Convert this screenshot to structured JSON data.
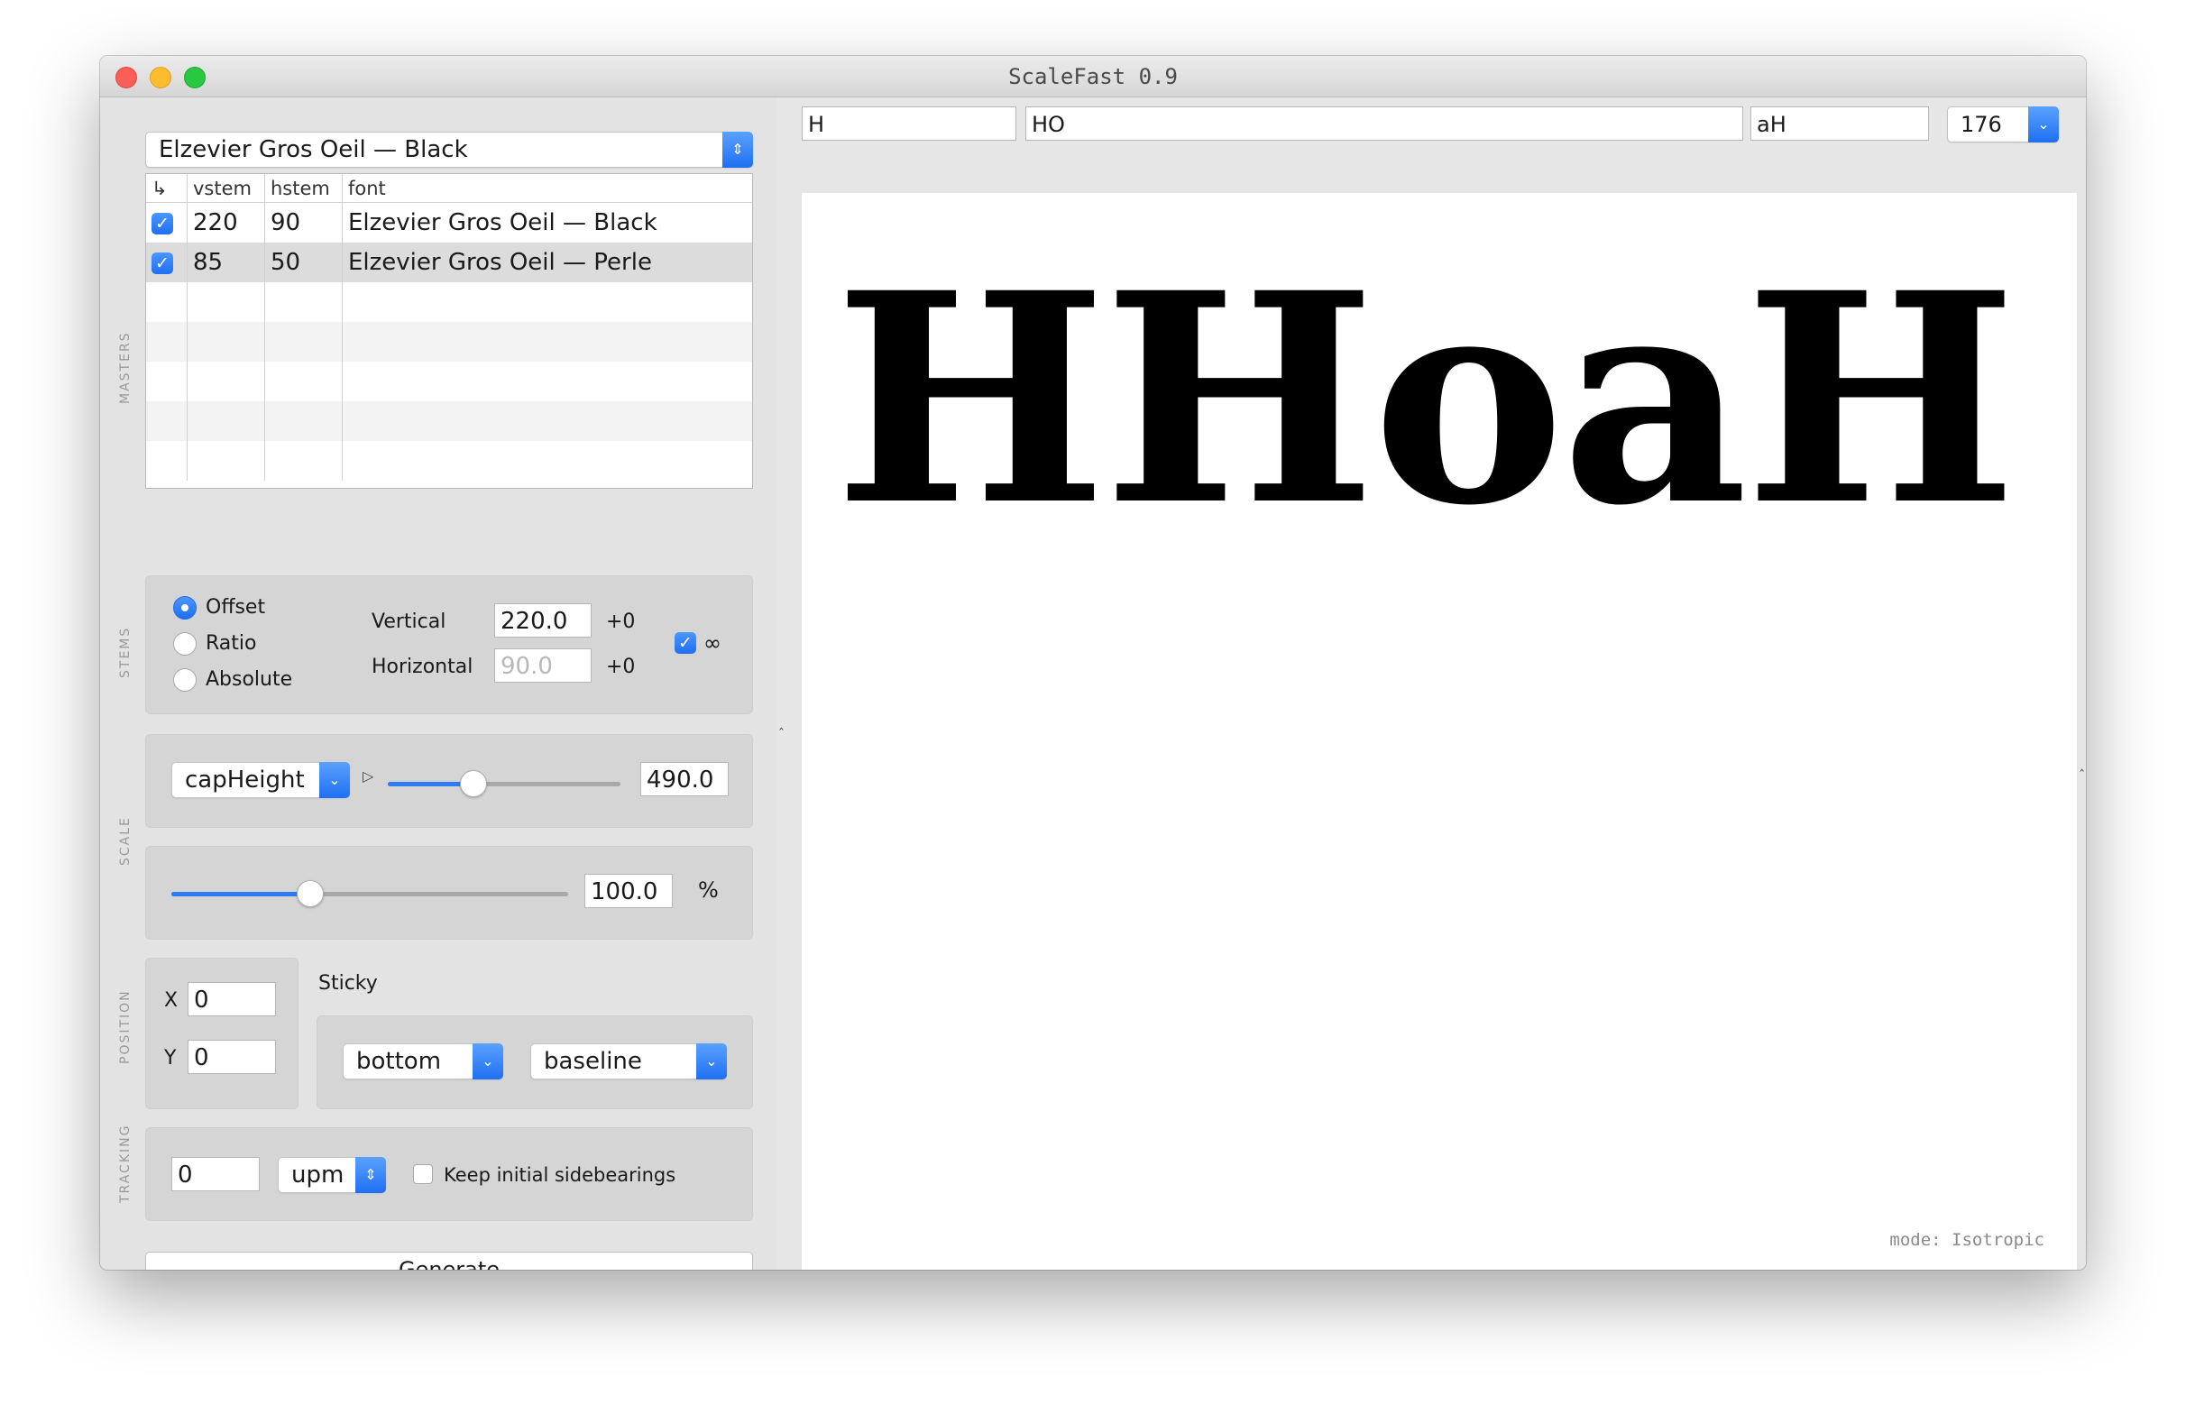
{
  "window": {
    "title": "ScaleFast 0.9"
  },
  "sections": {
    "masters": "MASTERS",
    "stems": "STEMS",
    "scale": "SCALE",
    "position": "POSITION",
    "tracking": "TRACKING"
  },
  "font_select": {
    "value": "Elzevier Gros Oeil — Black"
  },
  "masters_table": {
    "columns": [
      "↳",
      "vstem",
      "hstem",
      "font"
    ],
    "rows": [
      {
        "checked": true,
        "vstem": "220",
        "hstem": "90",
        "font": "Elzevier Gros Oeil — Black"
      },
      {
        "checked": true,
        "vstem": "85",
        "hstem": "50",
        "font": "Elzevier Gros Oeil — Perle"
      }
    ]
  },
  "stems": {
    "modes": [
      "Offset",
      "Ratio",
      "Absolute"
    ],
    "selected_mode": "Offset",
    "vertical_label": "Vertical",
    "vertical_value": "220.0",
    "vertical_delta": "+0",
    "horizontal_label": "Horizontal",
    "horizontal_value": "90.0",
    "horizontal_delta": "+0",
    "link_symbol": "∞",
    "linked": true
  },
  "scale": {
    "reference": "capHeight",
    "play_symbol": "▷",
    "height_value": "490.0",
    "height_slider_level": 0.37,
    "percent_value": "100.0",
    "percent_symbol": "%",
    "percent_slider_level": 0.35
  },
  "position": {
    "x_label": "X",
    "x_value": "0",
    "y_label": "Y",
    "y_value": "0",
    "sticky_label": "Sticky",
    "sticky_vertical": "bottom",
    "sticky_anchor": "baseline"
  },
  "tracking": {
    "value": "0",
    "unit": "upm",
    "keep_sidebearings_label": "Keep initial sidebearings",
    "keep_sidebearings": false
  },
  "generate_label": "Generate",
  "preview": {
    "string_1": "H",
    "string_2": "HO",
    "string_3": "aH",
    "size": "176",
    "sample": "HHoaH",
    "mode": "mode: Isotropic"
  },
  "colors": {
    "accent": "#2e7bf6",
    "close": "#fc5f57",
    "minimize": "#fdbc2e",
    "maximize": "#28c840"
  }
}
